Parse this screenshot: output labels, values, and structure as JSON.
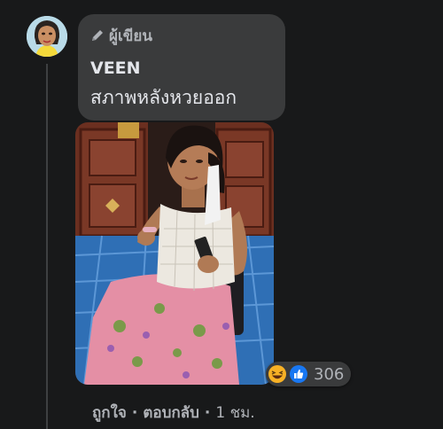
{
  "comment": {
    "badge_label": "ผู้เขียน",
    "author": "VEEN",
    "text": "สภาพหลังหวยออก"
  },
  "reactions": {
    "icons": [
      "haha-icon",
      "like-icon"
    ],
    "count": "306"
  },
  "actions": {
    "like": "ถูกใจ",
    "separator": "·",
    "reply": "ตอบกลับ",
    "time": "1 ชม."
  },
  "colors": {
    "background": "#18191a",
    "bubble": "#3a3b3c",
    "text_primary": "#e4e6eb",
    "text_secondary": "#b0b3b8",
    "like_blue": "#1877f2",
    "haha_yellow": "#f7b125"
  }
}
